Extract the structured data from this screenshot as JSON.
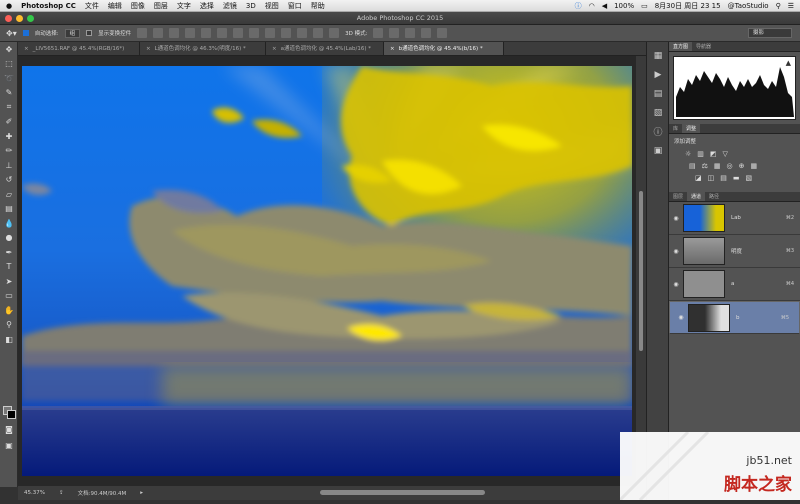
{
  "menubar": {
    "app_name": "Photoshop CC",
    "items": [
      "文件",
      "编辑",
      "图像",
      "图层",
      "文字",
      "选择",
      "滤镜",
      "3D",
      "视图",
      "窗口",
      "帮助"
    ],
    "battery": "100%",
    "datetime": "8月30日 周日  23 15",
    "user": "@TaoStudio"
  },
  "window": {
    "title": "Adobe Photoshop CC 2015"
  },
  "options": {
    "auto_select_label": "自动选择:",
    "auto_select_value": "组",
    "show_transform_label": "显示变换控件",
    "mode_3d_label": "3D 模式:",
    "workspace": "摄影"
  },
  "tabs": [
    {
      "label": "_LIV5651.RAF @ 45.4%(RGB/16*)",
      "close": "×"
    },
    {
      "label": "L通道色调均化 @ 46.3%(明度/16) *",
      "close": "×"
    },
    {
      "label": "a通道色调均化 @ 45.4%(Lab/16) *",
      "close": "×"
    },
    {
      "label": "b通道色调均化 @ 45.4%(b/16) *",
      "close": "×"
    }
  ],
  "status": {
    "zoom": "45.37%",
    "doc": "文档:90.4M/90.4M"
  },
  "panels": {
    "histogram_tabs": [
      "直方图",
      "导航器"
    ],
    "adjust_tabs": [
      "库",
      "调整"
    ],
    "adjust_title": "添加调整",
    "adjust_icons_row1": [
      "☼",
      "▥",
      "◩",
      "▽"
    ],
    "adjust_icons_row2": [
      "▤",
      "⚖",
      "▦",
      "◎",
      "⊕",
      "▦"
    ],
    "adjust_icons_row3": [
      "◪",
      "◫",
      "▤",
      "▬",
      "▧"
    ],
    "channels_tabs": [
      "图层",
      "通道",
      "路径"
    ],
    "channels": [
      {
        "name": "Lab",
        "key": "⌘2",
        "selected": false
      },
      {
        "name": "明度",
        "key": "⌘3",
        "selected": false
      },
      {
        "name": "a",
        "key": "⌘4",
        "selected": false
      },
      {
        "name": "b",
        "key": "⌘5",
        "selected": true
      }
    ]
  },
  "watermark": {
    "site": "jb51.net",
    "name": "脚本之家"
  }
}
